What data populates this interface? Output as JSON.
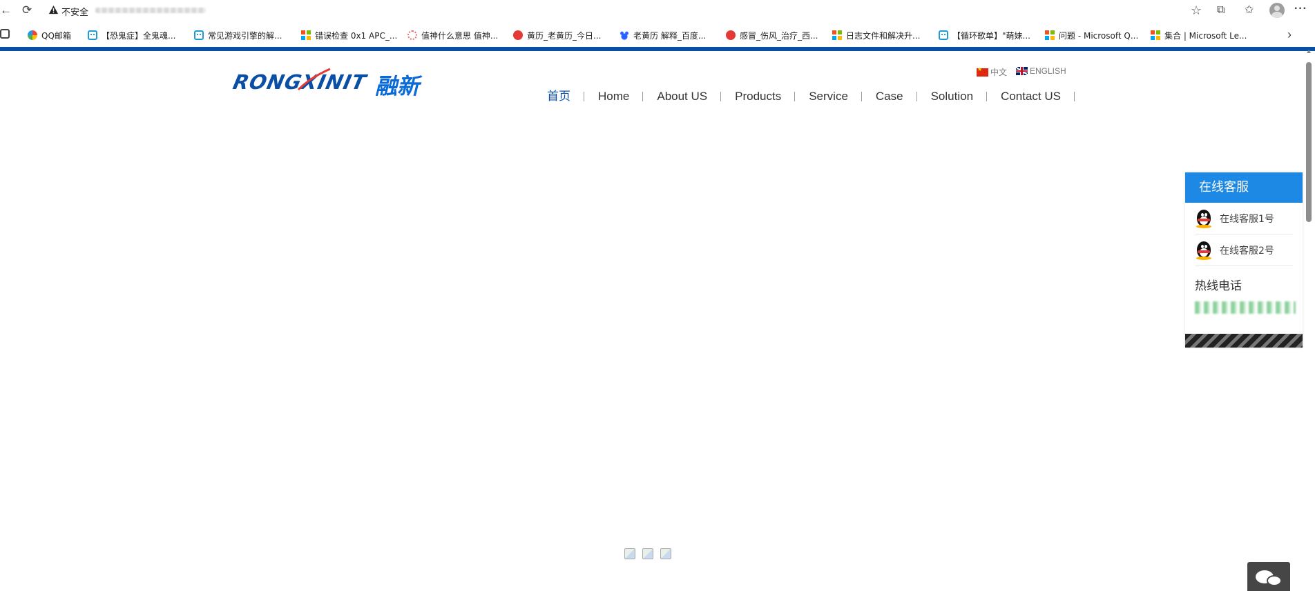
{
  "browser": {
    "security_label": "不安全",
    "bookmarks": [
      {
        "label": "QQ邮箱",
        "icon": "qq-mail-icon"
      },
      {
        "label": "【恐鬼症】全鬼魂...",
        "icon": "bilibili-icon"
      },
      {
        "label": "常见游戏引擎的解...",
        "icon": "bilibili-icon"
      },
      {
        "label": "错误检查 0x1 APC_...",
        "icon": "microsoft-icon"
      },
      {
        "label": "值神什么意思 值神...",
        "icon": "flower-icon"
      },
      {
        "label": "黄历_老黄历_今日...",
        "icon": "yinyang-icon"
      },
      {
        "label": "老黄历 解释_百度...",
        "icon": "baidu-paw-icon"
      },
      {
        "label": "感冒_伤风_治疗_西...",
        "icon": "health-icon"
      },
      {
        "label": "日志文件和解决升...",
        "icon": "microsoft-icon"
      },
      {
        "label": "【循环歌单】\"萌妹...",
        "icon": "bilibili-icon"
      },
      {
        "label": "问题 - Microsoft Q...",
        "icon": "microsoft-icon"
      },
      {
        "label": "集合 | Microsoft Le...",
        "icon": "microsoft-icon"
      }
    ]
  },
  "site": {
    "logo_text": "RONGXINIT",
    "logo_cn": "融新",
    "lang_cn": "中文",
    "lang_en": "ENGLISH",
    "nav": [
      "首页",
      "Home",
      "About US",
      "Products",
      "Service",
      "Case",
      "Solution",
      "Contact US"
    ],
    "active_nav": "首页"
  },
  "service_panel": {
    "title": "在线客服",
    "agents": [
      "在线客服1号",
      "在线客服2号"
    ],
    "hotline_title": "热线电话"
  },
  "colors": {
    "brand_blue": "#0a4fa6",
    "panel_blue": "#1e88e5",
    "wechat_bg": "#464646"
  }
}
